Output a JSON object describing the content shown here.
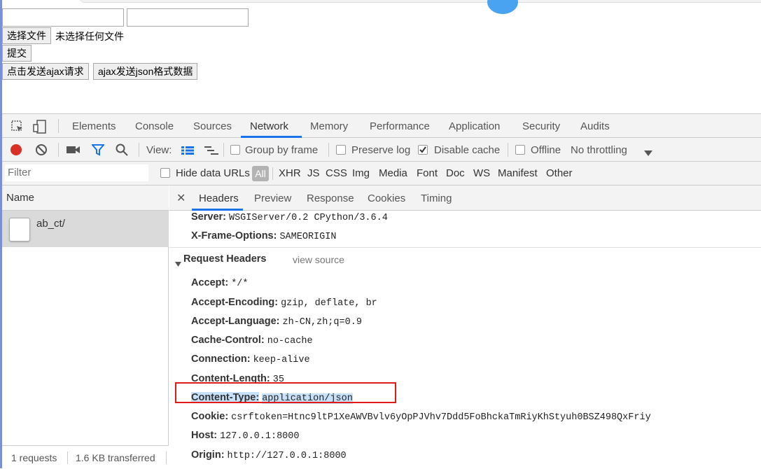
{
  "page": {
    "choose_file_button": "选择文件",
    "no_file_text": "未选择任何文件",
    "submit_button": "提交",
    "ajax_button": "点击发送ajax请求",
    "json_button": "ajax发送json格式数据"
  },
  "devtools": {
    "tabs": [
      "Elements",
      "Console",
      "Sources",
      "Network",
      "Memory",
      "Performance",
      "Application",
      "Security",
      "Audits"
    ],
    "active_tab": "Network",
    "toolbar": {
      "view_label": "View:",
      "group_by_frame": "Group by frame",
      "preserve_log": "Preserve log",
      "disable_cache": "Disable cache",
      "offline": "Offline",
      "throttling": "No throttling"
    },
    "filter": {
      "placeholder": "Filter",
      "hide_data_urls": "Hide data URLs",
      "types": [
        "All",
        "XHR",
        "JS",
        "CSS",
        "Img",
        "Media",
        "Font",
        "Doc",
        "WS",
        "Manifest",
        "Other"
      ]
    },
    "name_header": "Name",
    "request_name": "ab_ct/",
    "status": {
      "requests": "1 requests",
      "transferred": "1.6 KB transferred"
    },
    "detail_tabs": [
      "Headers",
      "Preview",
      "Response",
      "Cookies",
      "Timing"
    ],
    "response_headers": [
      {
        "key": "Server:",
        "value": "WSGIServer/0.2 CPython/3.6.4"
      },
      {
        "key": "X-Frame-Options:",
        "value": "SAMEORIGIN"
      }
    ],
    "request_headers_title": "Request Headers",
    "view_source": "view source",
    "request_headers": [
      {
        "key": "Accept:",
        "value": "*/*"
      },
      {
        "key": "Accept-Encoding:",
        "value": "gzip, deflate, br"
      },
      {
        "key": "Accept-Language:",
        "value": "zh-CN,zh;q=0.9"
      },
      {
        "key": "Cache-Control:",
        "value": "no-cache"
      },
      {
        "key": "Connection:",
        "value": "keep-alive"
      },
      {
        "key": "Content-Length:",
        "value": "35"
      },
      {
        "key": "Content-Type:",
        "value": "application/json"
      },
      {
        "key": "Cookie:",
        "value": "csrftoken=Htnc9ltP1XeAWVBvlv6yOpPJVhv7Ddd5FoBhckaTmRiyKhStyuh0BSZ498QxFriy"
      },
      {
        "key": "Host:",
        "value": "127.0.0.1:8000"
      },
      {
        "key": "Origin:",
        "value": "http://127.0.0.1:8000"
      }
    ]
  },
  "colors": {
    "accent": "#1a73e8",
    "record": "#d93025",
    "highlight_box": "#e21a1a"
  }
}
